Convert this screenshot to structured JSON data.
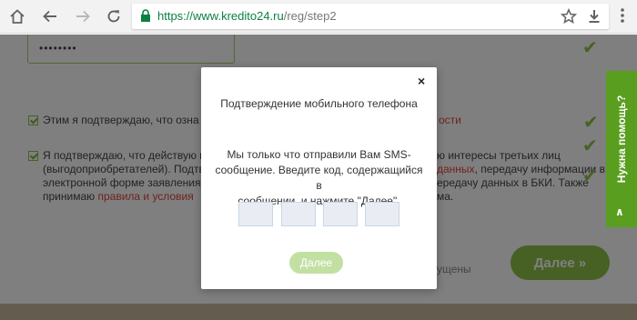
{
  "browser": {
    "url_host": "https://www.kredito24.ru",
    "url_path": "/reg/step2"
  },
  "page": {
    "password_mask": "••••••••",
    "line1": "Этим я подтверждаю, что озна",
    "line1_link": "ости",
    "p2_l1_left": "Я подтверждаю, что действую и",
    "p2_l1_right": "ю интересы третьих лиц",
    "p2_l2_left": "(выгодоприобретателей). Подтв",
    "p2_l2_link": "данных",
    "p2_l2_right": ", передачу информации в",
    "p2_l3_left": "электронной форме заявления",
    "p2_l3_right": "ередачу данных в БКИ. Также",
    "p2_l4_left": "принимаю ",
    "p2_l4_link": "правила и условия",
    "p2_l4_right": "ма.",
    "partial_word": "ущены",
    "next_label": "Далее »"
  },
  "help_tab": {
    "label": "Нужна помощь?",
    "chevron": "∧"
  },
  "modal": {
    "close": "×",
    "title": "Подтверждение мобильного телефона",
    "message_1": "Мы только что отправили Вам SMS-",
    "message_2": "сообщение. Введите код, содержащийся в",
    "message_3": "сообщении, и нажмите \"Далее\".",
    "button_label": "Далее"
  },
  "colors": {
    "accent_green": "#8fc34a",
    "link_red": "#e0443c",
    "help_green": "#5a9e1f"
  }
}
